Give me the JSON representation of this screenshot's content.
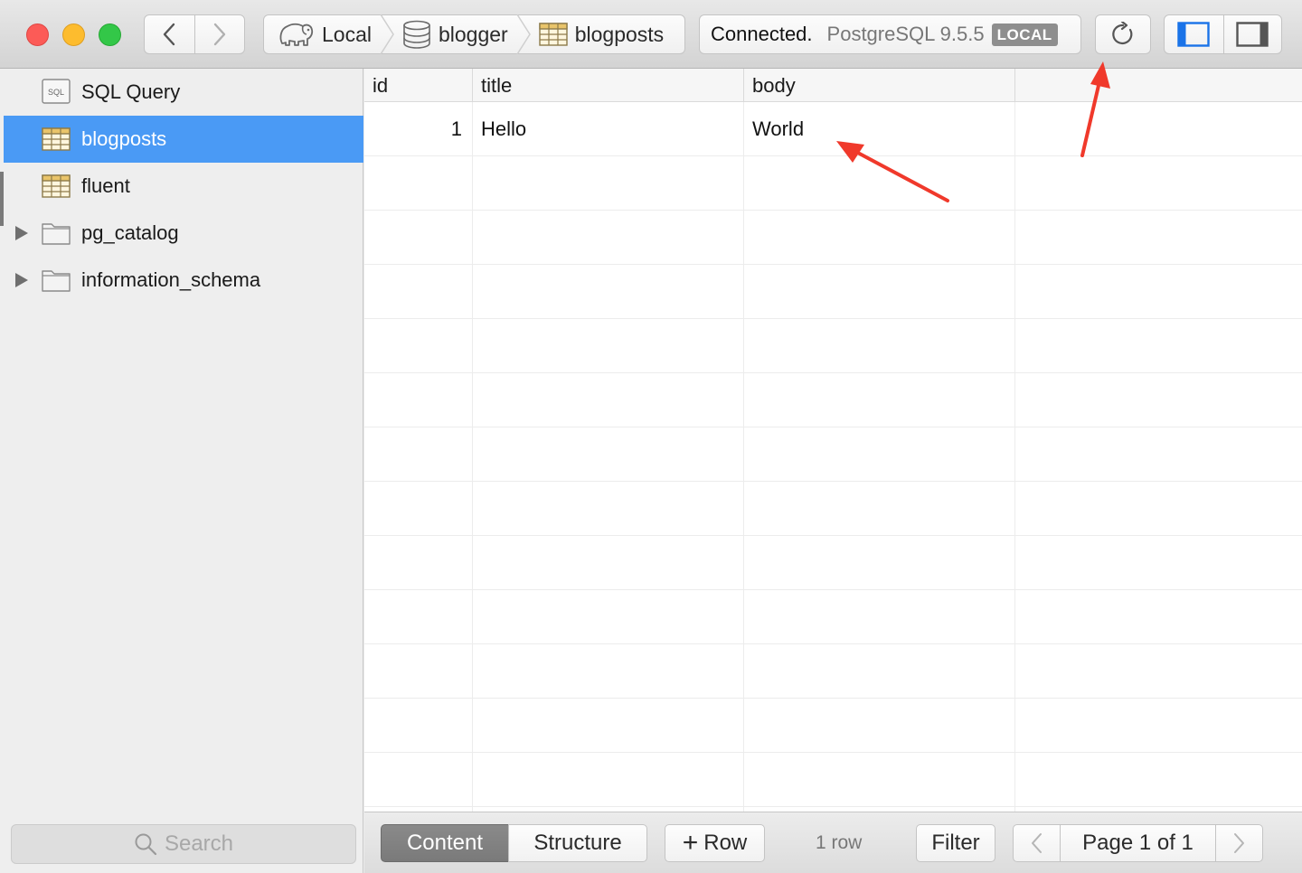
{
  "breadcrumb": {
    "connection": "Local",
    "database": "blogger",
    "table": "blogposts"
  },
  "status": {
    "text": "Connected.",
    "server": "PostgreSQL 9.5.5",
    "badge": "LOCAL"
  },
  "sidebar": {
    "items": [
      {
        "label": "SQL Query",
        "icon": "sql-query-icon",
        "icon_text": "SQL"
      },
      {
        "label": "blogposts",
        "icon": "table-icon",
        "selected": true
      },
      {
        "label": "fluent",
        "icon": "table-icon"
      },
      {
        "label": "pg_catalog",
        "icon": "folder-icon",
        "expandable": true
      },
      {
        "label": "information_schema",
        "icon": "folder-icon",
        "expandable": true
      }
    ],
    "search_placeholder": "Search"
  },
  "grid": {
    "columns": [
      "id",
      "title",
      "body"
    ],
    "rows": [
      {
        "id": "1",
        "title": "Hello",
        "body": "World"
      }
    ]
  },
  "bottom": {
    "tab_content": "Content",
    "tab_structure": "Structure",
    "add_row": "Row",
    "row_count": "1 row",
    "filter": "Filter",
    "page": "Page 1 of 1"
  },
  "colors": {
    "selection": "#4a9af5",
    "annotation_arrow": "#f0392b",
    "toggle_accent": "#1a73e8"
  }
}
